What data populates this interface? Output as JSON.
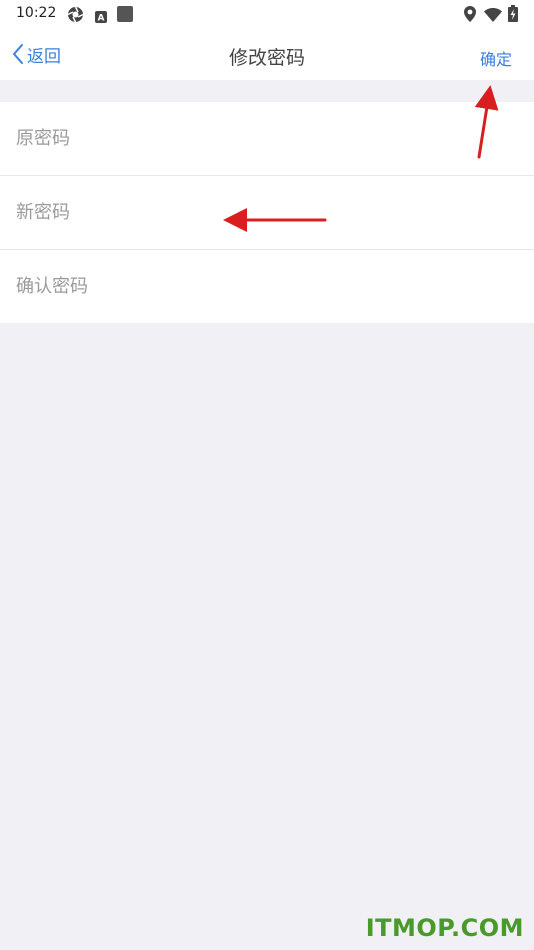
{
  "status_bar": {
    "time": "10:22",
    "left_icons": [
      "aperture-icon",
      "a-square-icon",
      "app-square-icon"
    ],
    "right_icons": [
      "location-icon",
      "wifi-icon",
      "battery-charging-icon"
    ]
  },
  "nav": {
    "back_label": "返回",
    "title": "修改密码",
    "confirm_label": "确定",
    "accent_color": "#3a7fdc"
  },
  "form": {
    "fields": [
      {
        "placeholder": "原密码",
        "value": ""
      },
      {
        "placeholder": "新密码",
        "value": ""
      },
      {
        "placeholder": "确认密码",
        "value": ""
      }
    ]
  },
  "annotations": {
    "arrow_color": "#d81e1e",
    "arrows": [
      "arrow-to-confirm",
      "arrow-to-new-password"
    ]
  },
  "watermark": {
    "text": "ITMOP.COM",
    "color": "#4a9a2a"
  },
  "colors": {
    "background": "#f0f0f5",
    "surface": "#ffffff",
    "divider": "#e6e6ea",
    "placeholder": "#9a9a9a"
  }
}
